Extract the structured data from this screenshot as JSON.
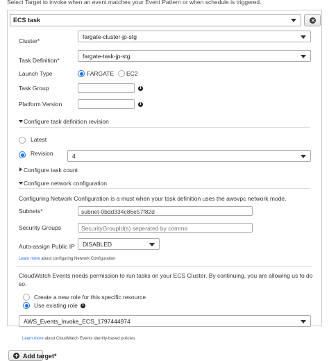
{
  "intro_text": "Select Target to invoke when an event matches your Event Pattern or when schedule is triggered.",
  "target_type": "ECS task",
  "cluster": {
    "label": "Cluster*",
    "value": "fargate-cluster-jp-stg"
  },
  "task_definition": {
    "label": "Task Definition*",
    "value": "fargate-task-jp-stg"
  },
  "launch_type": {
    "label": "Launch Type",
    "options": [
      "FARGATE",
      "EC2"
    ],
    "selected": "FARGATE"
  },
  "task_group": {
    "label": "Task Group",
    "value": ""
  },
  "platform_version": {
    "label": "Platform Version",
    "value": ""
  },
  "configure_revision": {
    "header": "Configure task definition revision",
    "latest_label": "Latest",
    "revision_label": "Revision",
    "revision_value": "4"
  },
  "configure_task_count": {
    "header": "Configure task count"
  },
  "network": {
    "header": "Configure network configuration",
    "description": "Configuring Network Configuration is a must when your task definition uses the awsvpc network mode.",
    "subnets_label": "Subnets*",
    "subnets_value": "subnet-0bdd334c86e57f82d",
    "security_groups_label": "Security Groups",
    "security_groups_placeholder": "SecurityGroupId(s) seperated by comma",
    "public_ip_label": "Auto-assign Public IP",
    "public_ip_value": "DISABLED",
    "learn_more_link": "Learn more",
    "learn_more_text": "about configuring Network Configuration"
  },
  "permissions": {
    "description_line1": "CloudWatch Events needs permission to run tasks on your ECS Cluster. By continuing, you are allowing us to do",
    "description_line2": "so.",
    "create_role_label": "Create a new role for this specific resource",
    "existing_role_label": "Use existing role",
    "role_value": "AWS_Events_Invoke_ECS_1797444974",
    "learn_more_link": "Learn more",
    "learn_more_text": "about CloudWatch Events identity-based policies."
  },
  "add_target_label": "Add target*",
  "colors": {
    "accent": "#1a73e8",
    "border": "#aaaaaa"
  }
}
